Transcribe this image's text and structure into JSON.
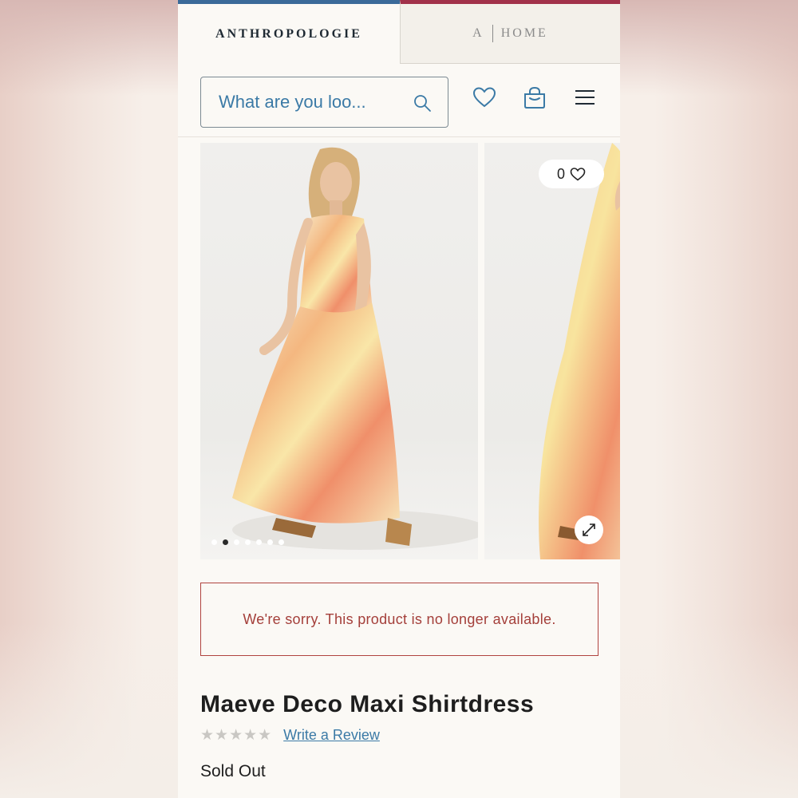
{
  "tabs": {
    "brand": "ANTHROPOLOGIE",
    "home_a": "A",
    "home_label": "HOME"
  },
  "search": {
    "placeholder": "What are you loo..."
  },
  "header_icons": [
    "heart-icon",
    "bag-icon",
    "menu-icon"
  ],
  "gallery": {
    "dot_count": 7,
    "active_dot": 1,
    "favorite_count": "0"
  },
  "notice": {
    "text": "We're sorry. This product is no longer available."
  },
  "product": {
    "title": "Maeve Deco Maxi Shirtdress",
    "stars": "★★★★★",
    "review_link": "Write a Review",
    "availability": "Sold Out"
  },
  "colors": {
    "accent_blue": "#3b7aa6",
    "tab_blue": "#3b6a99",
    "tab_red": "#a1314a",
    "alert_red": "#a43f3a"
  }
}
